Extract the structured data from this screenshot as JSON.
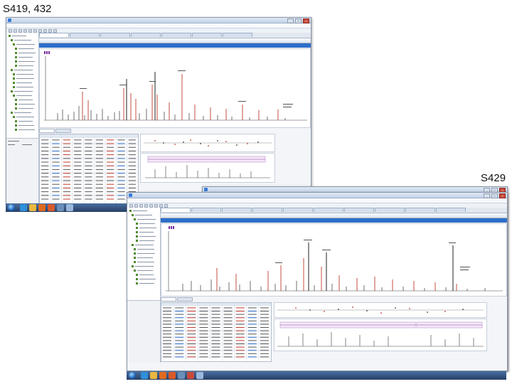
{
  "captions": {
    "top_left": "S419, 432",
    "right": "S429"
  },
  "colors": {
    "accent": "#2d6ec9",
    "peak_match": "#c0392b",
    "peak_unmatched": "#333333",
    "taskbar": "#263f66"
  },
  "icons": {
    "start": "windows-start-orb",
    "taskbar_apps": [
      "internet-explorer-icon",
      "folder-icon",
      "media-player-icon",
      "firefox-icon",
      "app-icon",
      "office-icon",
      "spectrum-app-icon"
    ]
  }
}
